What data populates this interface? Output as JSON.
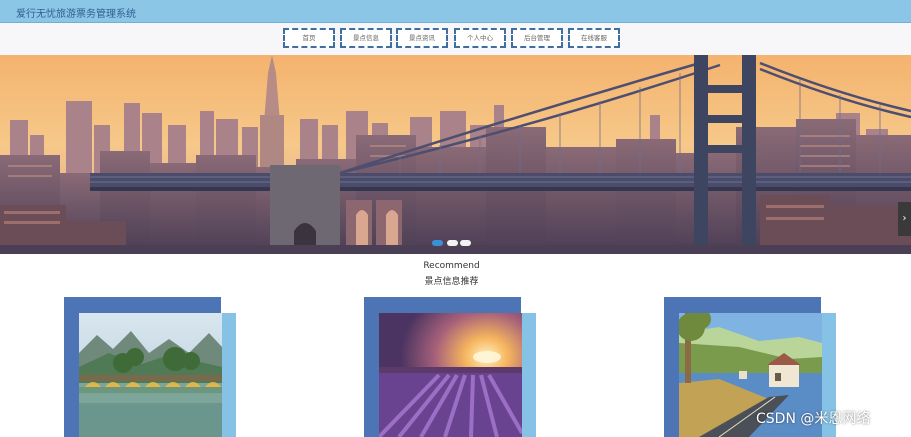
{
  "header": {
    "title": "爱行无忧旅游票务管理系统"
  },
  "nav": {
    "items": [
      {
        "label": "首页"
      },
      {
        "label": "景点信息"
      },
      {
        "label": "景点资讯"
      },
      {
        "label": "个人中心"
      },
      {
        "label": "后台管理"
      },
      {
        "label": "在线客服"
      }
    ]
  },
  "banner": {
    "slide_count": 3,
    "active_slide": 1
  },
  "recommend": {
    "subtitle": "Recommend",
    "title": "景点信息推荐"
  },
  "watermark": "CSDN @米恩网络",
  "colors": {
    "topbar": "#8cc6e7",
    "nav_border": "#3f6fa0",
    "card_back": "#4d74b4",
    "card_side": "#86c2e6"
  }
}
